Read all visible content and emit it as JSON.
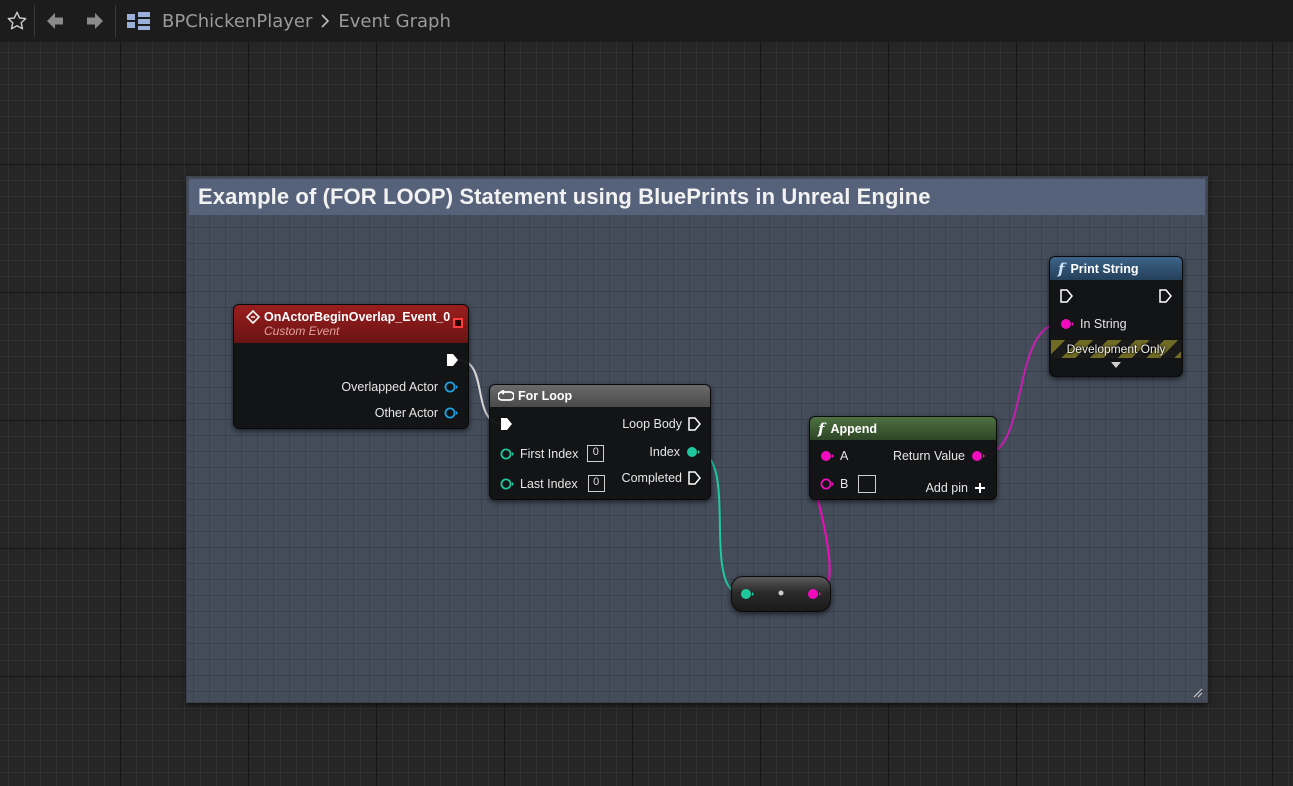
{
  "toolbar": {
    "favorite_icon": "star-icon",
    "back_icon": "back-arrow-icon",
    "forward_icon": "forward-arrow-icon",
    "blueprint_icon": "event-graph-icon",
    "breadcrumb": [
      "BPChickenPlayer",
      "Event Graph"
    ]
  },
  "comment": {
    "title": "Example of (FOR LOOP) Statement using BluePrints in Unreal Engine"
  },
  "nodes": {
    "event": {
      "title": "OnActorBeginOverlap_Event_0",
      "subtitle": "Custom Event",
      "pins": [
        "Overlapped Actor",
        "Other Actor"
      ],
      "header_color": "#8c1a1a"
    },
    "for_loop": {
      "title": "For Loop",
      "inputs": [
        {
          "label": "First Index",
          "value": "0"
        },
        {
          "label": "Last Index",
          "value": "0"
        }
      ],
      "outputs": [
        "Loop Body",
        "Index",
        "Completed"
      ]
    },
    "append": {
      "title": "Append",
      "inputs": [
        "A",
        "B"
      ],
      "output": "Return Value",
      "add_pin": "Add pin",
      "header_color": "#3e5a34"
    },
    "print_string": {
      "title": "Print String",
      "input": "In String",
      "dev_only": "Development Only",
      "header_color": "#2c4a64"
    }
  },
  "colors": {
    "int_pin": "#1ec9a0",
    "string_pin": "#f00cbc",
    "object_pin": "#1aa3e0",
    "exec_pin": "#ffffff",
    "background": "#262626"
  }
}
